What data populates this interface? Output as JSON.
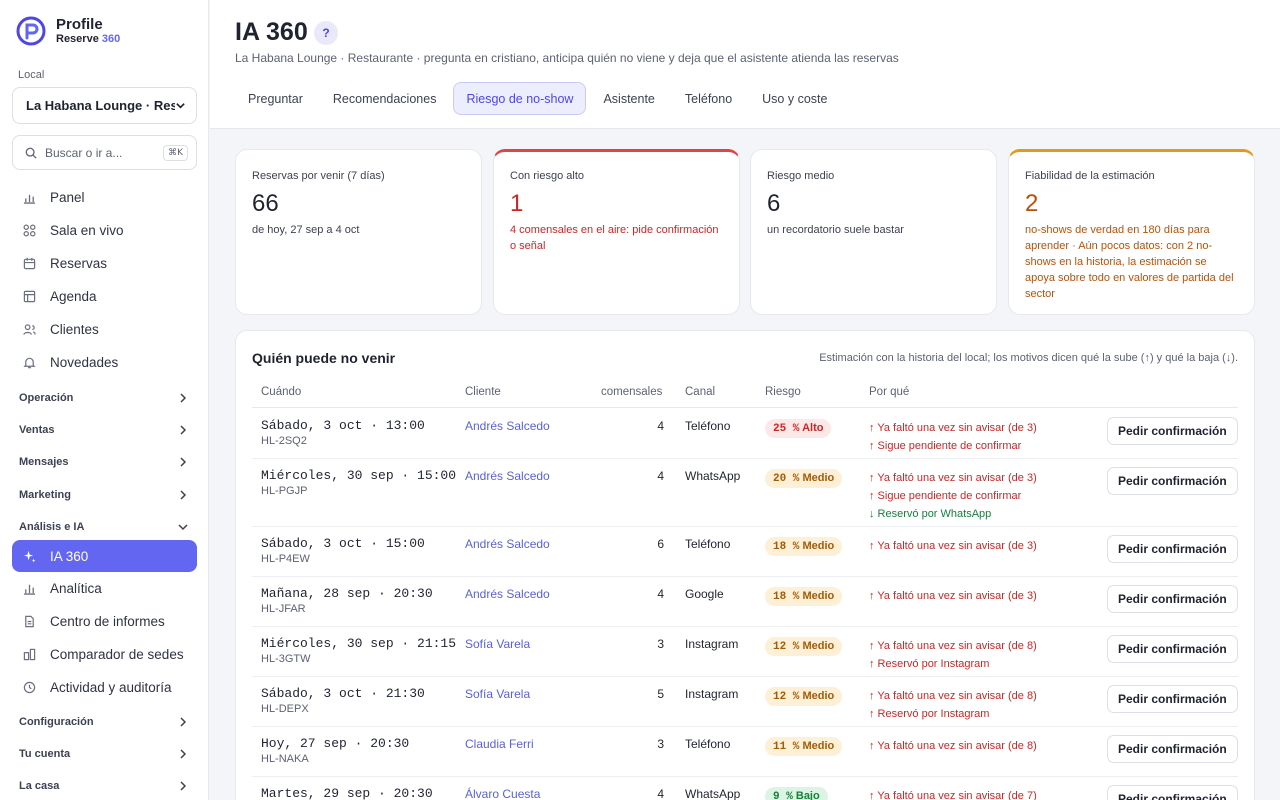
{
  "brand": {
    "name": "Profile",
    "sub_prefix": "Reserve",
    "sub_num": "360",
    "accent": "#6366f1"
  },
  "sidebar": {
    "local_label": "Local",
    "local_value": "La Habana Lounge · Rest",
    "search_placeholder": "Buscar o ir a...",
    "search_shortcut": "⌘K",
    "items": [
      {
        "label": "Panel",
        "icon": "chart-bar-icon"
      },
      {
        "label": "Sala en vivo",
        "icon": "grid-icon"
      },
      {
        "label": "Reservas",
        "icon": "calendar-icon"
      },
      {
        "label": "Agenda",
        "icon": "table-icon"
      },
      {
        "label": "Clientes",
        "icon": "users-icon"
      },
      {
        "label": "Novedades",
        "icon": "bell-icon"
      }
    ],
    "groups": [
      {
        "label": "Operación",
        "expanded": false
      },
      {
        "label": "Ventas",
        "expanded": false
      },
      {
        "label": "Mensajes",
        "expanded": false
      },
      {
        "label": "Marketing",
        "expanded": false
      },
      {
        "label": "Análisis e IA",
        "expanded": true
      }
    ],
    "analysis_items": [
      {
        "label": "IA 360",
        "icon": "sparkle-icon",
        "active": true
      },
      {
        "label": "Analítica",
        "icon": "chart-bar-icon"
      },
      {
        "label": "Centro de informes",
        "icon": "document-icon"
      },
      {
        "label": "Comparador de sedes",
        "icon": "compare-icon"
      },
      {
        "label": "Actividad y auditoría",
        "icon": "clock-icon"
      }
    ],
    "bottom_groups": [
      {
        "label": "Configuración"
      },
      {
        "label": "Tu cuenta"
      },
      {
        "label": "La casa"
      }
    ]
  },
  "header": {
    "title": "IA 360",
    "help": "?",
    "subtitle": "La Habana Lounge · Restaurante · pregunta en cristiano, anticipa quién no viene y deja que el asistente atienda las reservas",
    "tabs": [
      {
        "label": "Preguntar"
      },
      {
        "label": "Recomendaciones"
      },
      {
        "label": "Riesgo de no-show",
        "active": true
      },
      {
        "label": "Asistente"
      },
      {
        "label": "Teléfono"
      },
      {
        "label": "Uso y coste"
      }
    ]
  },
  "stats": [
    {
      "label": "Reservas por venir (7 días)",
      "value": "66",
      "note": "de hoy, 27 sep a 4 oct"
    },
    {
      "label": "Con riesgo alto",
      "value": "1",
      "note": "4 comensales en el aire: pide confirmación o señal"
    },
    {
      "label": "Riesgo medio",
      "value": "6",
      "note": "un recordatorio suele bastar"
    },
    {
      "label": "Fiabilidad de la estimación",
      "value": "2",
      "note": "no-shows de verdad en 180 días para aprender · Aún pocos datos: con 2 no-shows en la historia, la estimación se apoya sobre todo en valores de partida del sector"
    }
  ],
  "table": {
    "title": "Quién puede no venir",
    "hint": "Estimación con la historia del local; los motivos dicen qué la sube (↑) y qué la baja (↓).",
    "headers": {
      "when": "Cuándo",
      "client": "Cliente",
      "guests": "comensales",
      "channel": "Canal",
      "risk": "Riesgo",
      "why": "Por qué"
    },
    "action_label": "Pedir confirmación",
    "rows": [
      {
        "date": "Sábado, 3 oct · 13:00",
        "code": "HL-2SQ2",
        "client": "Andrés Salcedo",
        "guests": "4",
        "channel": "Teléfono",
        "pct": "25 %",
        "level": "Alto",
        "tone": "alto",
        "reasons": [
          "↑ Ya faltó una vez sin avisar (de 3)",
          "↑ Sigue pendiente de confirmar"
        ],
        "reason_dirs": [
          "up",
          "up"
        ]
      },
      {
        "date": "Miércoles, 30 sep · 15:00",
        "code": "HL-PGJP",
        "client": "Andrés Salcedo",
        "guests": "4",
        "channel": "WhatsApp",
        "pct": "20 %",
        "level": "Medio",
        "tone": "medio",
        "reasons": [
          "↑ Ya faltó una vez sin avisar (de 3)",
          "↑ Sigue pendiente de confirmar",
          "↓ Reservó por WhatsApp"
        ],
        "reason_dirs": [
          "up",
          "up",
          "down"
        ]
      },
      {
        "date": "Sábado, 3 oct · 15:00",
        "code": "HL-P4EW",
        "client": "Andrés Salcedo",
        "guests": "6",
        "channel": "Teléfono",
        "pct": "18 %",
        "level": "Medio",
        "tone": "medio",
        "reasons": [
          "↑ Ya faltó una vez sin avisar (de 3)"
        ],
        "reason_dirs": [
          "up"
        ]
      },
      {
        "date": "Mañana, 28 sep · 20:30",
        "code": "HL-JFAR",
        "client": "Andrés Salcedo",
        "guests": "4",
        "channel": "Google",
        "pct": "18 %",
        "level": "Medio",
        "tone": "medio",
        "reasons": [
          "↑ Ya faltó una vez sin avisar (de 3)"
        ],
        "reason_dirs": [
          "up"
        ]
      },
      {
        "date": "Miércoles, 30 sep · 21:15",
        "code": "HL-3GTW",
        "client": "Sofía Varela",
        "guests": "3",
        "channel": "Instagram",
        "pct": "12 %",
        "level": "Medio",
        "tone": "medio",
        "reasons": [
          "↑ Ya faltó una vez sin avisar (de 8)",
          "↑ Reservó por Instagram"
        ],
        "reason_dirs": [
          "up",
          "up"
        ]
      },
      {
        "date": "Sábado, 3 oct · 21:30",
        "code": "HL-DEPX",
        "client": "Sofía Varela",
        "guests": "5",
        "channel": "Instagram",
        "pct": "12 %",
        "level": "Medio",
        "tone": "medio",
        "reasons": [
          "↑ Ya faltó una vez sin avisar (de 8)",
          "↑ Reservó por Instagram"
        ],
        "reason_dirs": [
          "up",
          "up"
        ]
      },
      {
        "date": "Hoy, 27 sep · 20:30",
        "code": "HL-NAKA",
        "client": "Claudia Ferri",
        "guests": "3",
        "channel": "Teléfono",
        "pct": "11 %",
        "level": "Medio",
        "tone": "medio",
        "reasons": [
          "↑ Ya faltó una vez sin avisar (de 8)"
        ],
        "reason_dirs": [
          "up"
        ]
      },
      {
        "date": "Martes, 29 sep · 20:30",
        "code": "",
        "client": "Álvaro Cuesta",
        "guests": "4",
        "channel": "WhatsApp",
        "pct": "9 %",
        "level": "Bajo",
        "tone": "bajo",
        "reasons": [
          "↑ Ya faltó una vez sin avisar (de 7)"
        ],
        "reason_dirs": [
          "up"
        ]
      }
    ]
  },
  "colors": {
    "accent": "#6366f1",
    "high": "#c62828",
    "medium": "#a35b07",
    "low": "#15803d"
  }
}
